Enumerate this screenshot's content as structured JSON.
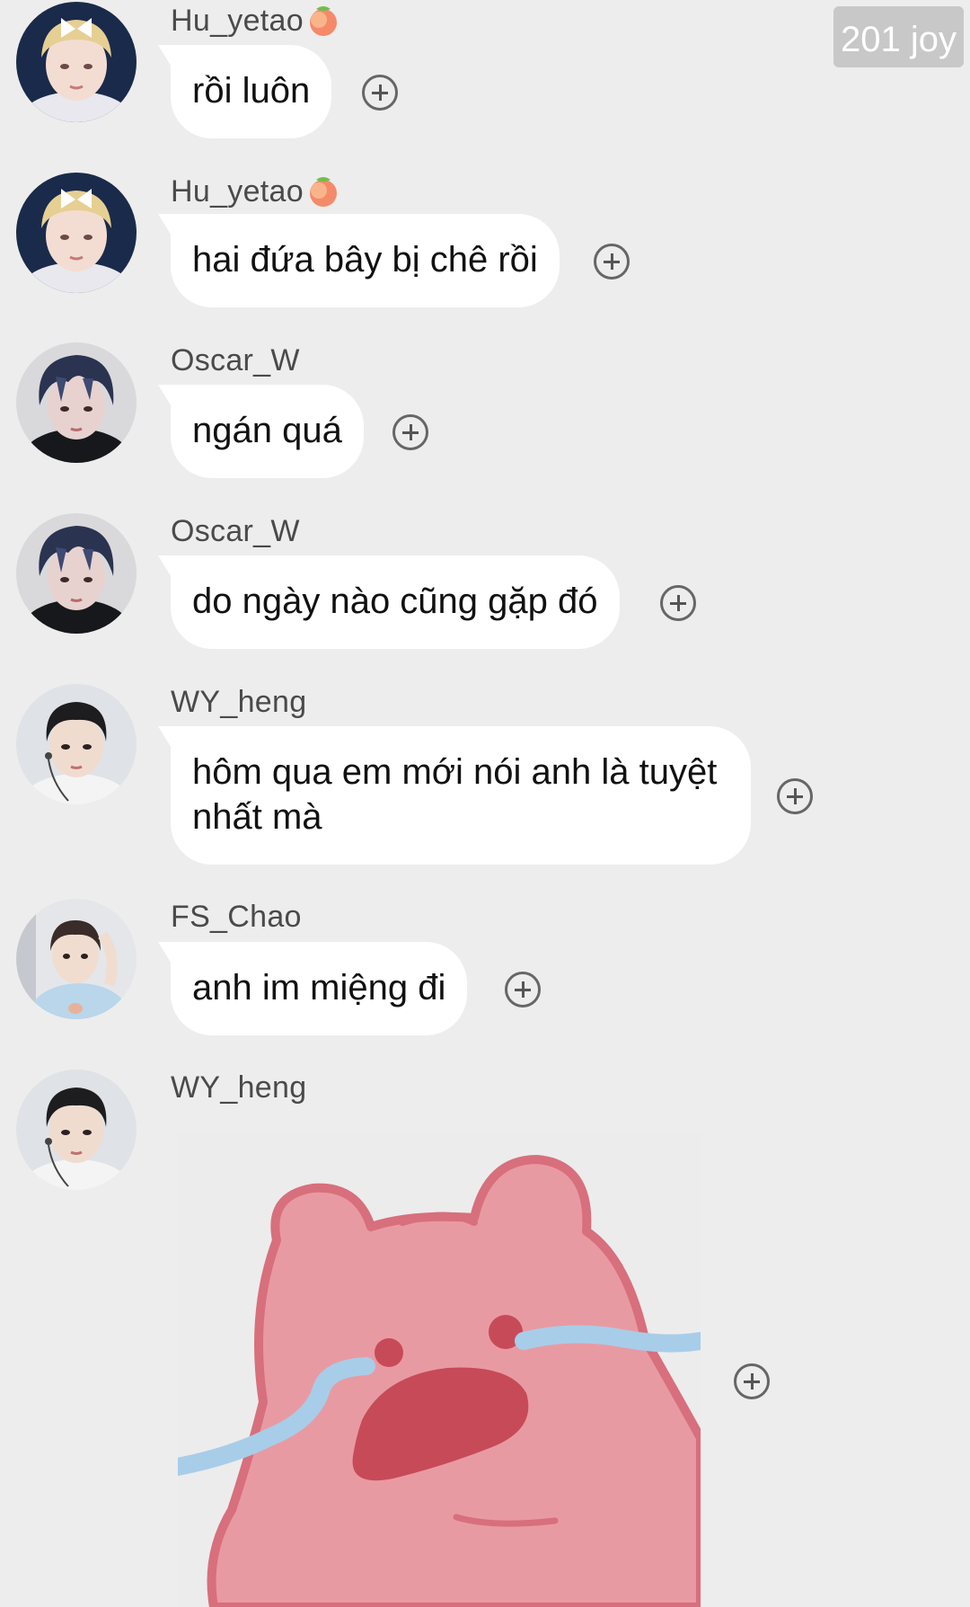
{
  "badge": "201 joy",
  "messages": [
    {
      "username": "Hu_yetao",
      "text": "rồi luôn",
      "avatar": "blonde-bow-avatar"
    },
    {
      "username": "Hu_yetao",
      "text": "hai đứa bây bị chê rồi",
      "avatar": "blonde-bow-avatar"
    },
    {
      "username": "Oscar_W",
      "text": "ngán quá",
      "avatar": "dark-blue-hair-avatar"
    },
    {
      "username": "Oscar_W",
      "text": "do ngày nào cũng gặp đó",
      "avatar": "dark-blue-hair-avatar"
    },
    {
      "username": "WY_heng",
      "text": "hôm qua em mới nói anh là tuyệt nhất mà",
      "avatar": "earphones-avatar"
    },
    {
      "username": "FS_Chao",
      "text": "anh im miệng đi",
      "avatar": "light-blue-sweater-avatar"
    },
    {
      "username": "WY_heng",
      "sticker": "crying-pink-bear-sticker",
      "avatar": "earphones-avatar"
    }
  ],
  "icons": {
    "peach": "peach-emoji-icon",
    "add": "plus-circle-icon"
  },
  "colors": {
    "background": "#ededed",
    "bubble": "#ffffff",
    "sticker_bear": "#e89aa2",
    "sticker_outline": "#d86f7c",
    "sticker_tears": "#a8cde8"
  }
}
